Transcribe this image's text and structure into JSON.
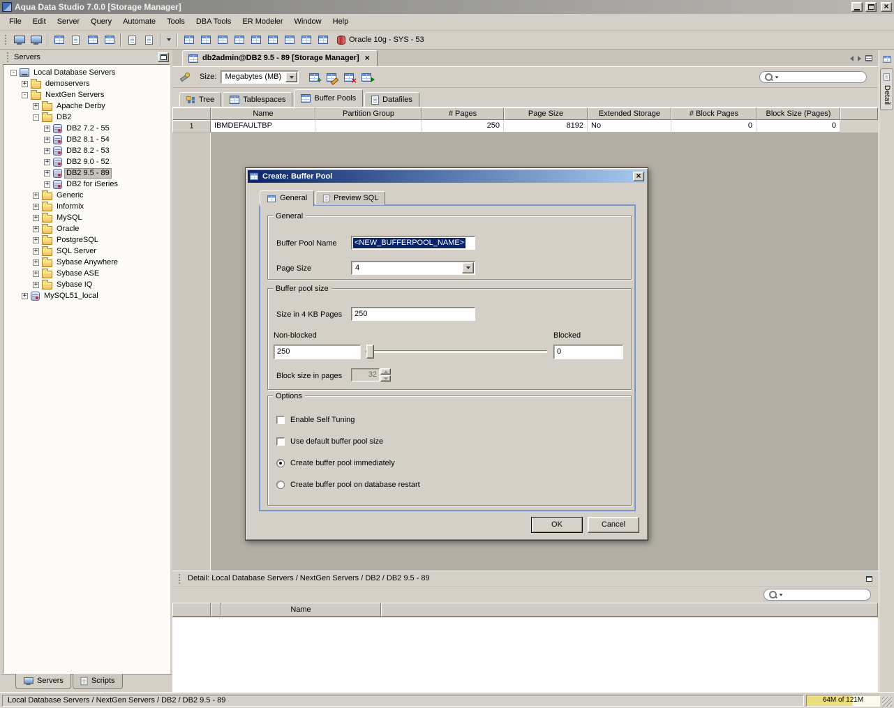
{
  "window": {
    "title": "Aqua Data Studio 7.0.0 [Storage Manager]"
  },
  "menu": {
    "items": [
      "File",
      "Edit",
      "Server",
      "Query",
      "Automate",
      "Tools",
      "DBA Tools",
      "ER Modeler",
      "Window",
      "Help"
    ]
  },
  "toolbar": {
    "connection": "Oracle 10g - SYS - 53"
  },
  "sidebar": {
    "title": "Servers",
    "tree": [
      {
        "label": "Local Database Servers",
        "expand": "-",
        "level": 0,
        "icon": "servers-root"
      },
      {
        "label": "demoservers",
        "expand": "+",
        "level": 1,
        "icon": "folder"
      },
      {
        "label": "NextGen Servers",
        "expand": "-",
        "level": 1,
        "icon": "folder"
      },
      {
        "label": "Apache Derby",
        "expand": "+",
        "level": 2,
        "icon": "folder"
      },
      {
        "label": "DB2",
        "expand": "-",
        "level": 2,
        "icon": "folder"
      },
      {
        "label": "DB2 7.2 - 55",
        "expand": "+",
        "level": 3,
        "icon": "database"
      },
      {
        "label": "DB2 8.1 - 54",
        "expand": "+",
        "level": 3,
        "icon": "database"
      },
      {
        "label": "DB2 8.2 - 53",
        "expand": "+",
        "level": 3,
        "icon": "database"
      },
      {
        "label": "DB2 9.0 - 52",
        "expand": "+",
        "level": 3,
        "icon": "database"
      },
      {
        "label": "DB2 9.5 - 89",
        "expand": "+",
        "level": 3,
        "icon": "database",
        "selected": true
      },
      {
        "label": "DB2 for iSeries",
        "expand": "+",
        "level": 3,
        "icon": "database"
      },
      {
        "label": "Generic",
        "expand": "+",
        "level": 2,
        "icon": "folder"
      },
      {
        "label": "Informix",
        "expand": "+",
        "level": 2,
        "icon": "folder"
      },
      {
        "label": "MySQL",
        "expand": "+",
        "level": 2,
        "icon": "folder"
      },
      {
        "label": "Oracle",
        "expand": "+",
        "level": 2,
        "icon": "folder"
      },
      {
        "label": "PostgreSQL",
        "expand": "+",
        "level": 2,
        "icon": "folder"
      },
      {
        "label": "SQL Server",
        "expand": "+",
        "level": 2,
        "icon": "folder"
      },
      {
        "label": "Sybase Anywhere",
        "expand": "+",
        "level": 2,
        "icon": "folder"
      },
      {
        "label": "Sybase ASE",
        "expand": "+",
        "level": 2,
        "icon": "folder"
      },
      {
        "label": "Sybase IQ",
        "expand": "+",
        "level": 2,
        "icon": "folder"
      },
      {
        "label": "MySQL51_local",
        "expand": "+",
        "level": 1,
        "icon": "database"
      }
    ],
    "tabs": [
      "Servers",
      "Scripts"
    ]
  },
  "document": {
    "tab_title": "db2admin@DB2 9.5 - 89 [Storage Manager]",
    "size_label": "Size:",
    "size_value": "Megabytes (MB)",
    "view_tabs": [
      "Tree",
      "Tablespaces",
      "Buffer Pools",
      "Datafiles"
    ],
    "grid": {
      "columns": [
        "Name",
        "Partition Group",
        "# Pages",
        "Page Size",
        "Extended Storage",
        "# Block Pages",
        "Block Size (Pages)"
      ],
      "rows": [
        {
          "num": "1",
          "name": "IBMDEFAULTBP",
          "partition_group": "",
          "pages": "250",
          "page_size": "8192",
          "extended_storage": "No",
          "block_pages": "0",
          "block_size": "0"
        }
      ]
    }
  },
  "dialog": {
    "title": "Create: Buffer Pool",
    "tabs": [
      "General",
      "Preview SQL"
    ],
    "general_group": {
      "title": "General",
      "buffer_pool_name_label": "Buffer Pool Name",
      "buffer_pool_name_value": "<NEW_BUFFERPOOL_NAME>",
      "page_size_label": "Page Size",
      "page_size_value": "4"
    },
    "size_group": {
      "title": "Buffer pool size",
      "size_pages_label": "Size in 4 KB Pages",
      "size_pages_value": "250",
      "non_blocked_label": "Non-blocked",
      "non_blocked_value": "250",
      "blocked_label": "Blocked",
      "blocked_value": "0",
      "block_size_label": "Block size in pages",
      "block_size_value": "32"
    },
    "options_group": {
      "title": "Options",
      "enable_self_tuning": "Enable Self Tuning",
      "use_default_size": "Use default buffer pool size",
      "create_immediately": "Create buffer pool immediately",
      "create_on_restart": "Create buffer pool on database restart"
    },
    "ok_label": "OK",
    "cancel_label": "Cancel"
  },
  "detail": {
    "title": "Detail: Local Database Servers / NextGen Servers / DB2 / DB2 9.5 - 89",
    "columns": [
      "Name"
    ]
  },
  "rightbar": {
    "tab": "Detail"
  },
  "statusbar": {
    "path": "Local Database Servers / NextGen Servers / DB2 / DB2 9.5 - 89",
    "memory": "64M of 121M"
  },
  "colors": {
    "chrome": "#d4d0c8",
    "selection": "#0a246a",
    "dialog_title_from": "#0a246a",
    "dialog_title_to": "#a6caf0",
    "memory_fill": "#eadd7e"
  },
  "icons": {
    "search": "magnifier",
    "close": "×",
    "dropdown": "down-triangle",
    "expand_collapsed": "+",
    "expand_expanded": "-",
    "folder": "yellow-folder",
    "database": "database-cylinder"
  }
}
